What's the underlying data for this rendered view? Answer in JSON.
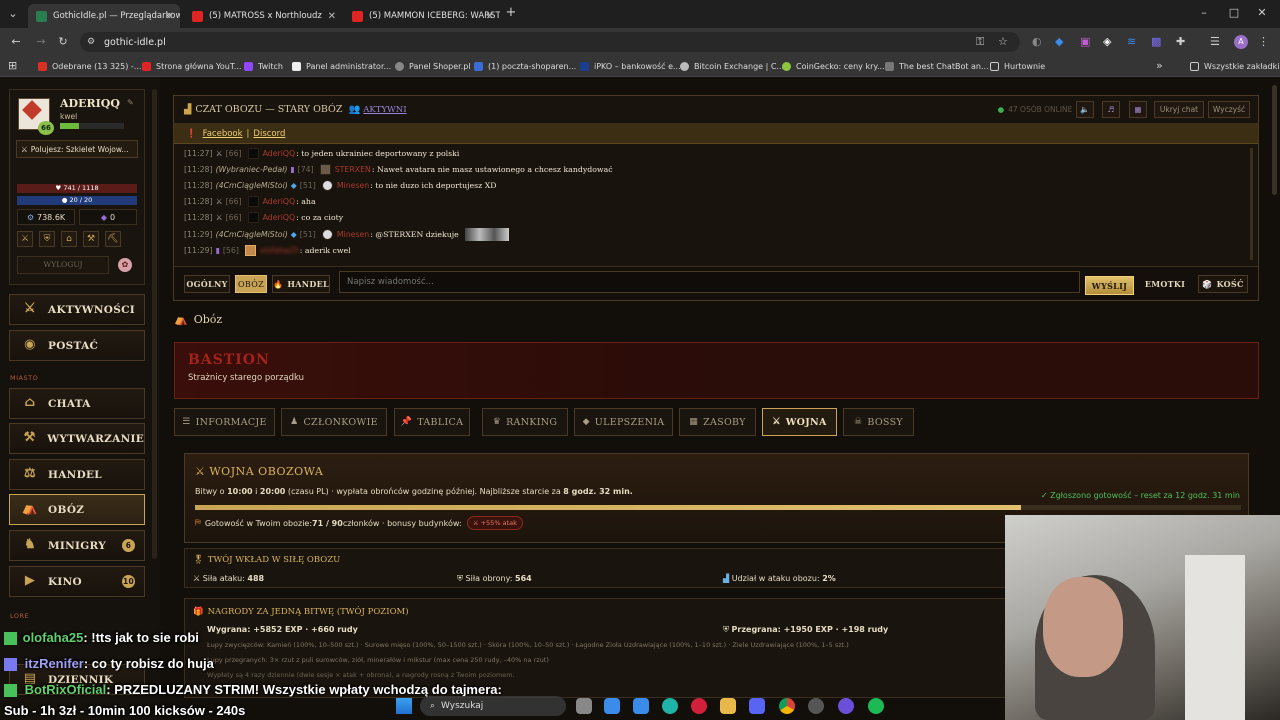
{
  "browser": {
    "tabs": [
      {
        "title": "GothicIdle.pl — Przeglądarkow",
        "active": true,
        "color": "#2a7d4f"
      },
      {
        "title": "(5) MATROSS x Northloudz",
        "active": false,
        "color": "#e02424"
      },
      {
        "title": "(5) MAMMON ICEBERG: WARST",
        "active": false,
        "color": "#e02424"
      }
    ],
    "url": "gothic-idle.pl",
    "bookmarks": [
      {
        "label": "Odebrane (13 325) -...",
        "color": "#d93025"
      },
      {
        "label": "Strona główna YouT...",
        "color": "#e02424"
      },
      {
        "label": "Twitch",
        "color": "#9146ff"
      },
      {
        "label": "Panel administrator...",
        "color": "#eeeeee"
      },
      {
        "label": "Panel Shoper.pl",
        "color": "#888888"
      },
      {
        "label": "(1) poczta-shoparen...",
        "color": "#3b6cd4"
      },
      {
        "label": "iPKO – bankowość e...",
        "color": "#1a3d8f"
      },
      {
        "label": "Bitcoin Exchange | C...",
        "color": "#bbbbbb"
      },
      {
        "label": "CoinGecko: ceny kry...",
        "color": "#8dc63f"
      },
      {
        "label": "The best ChatBot an...",
        "color": "#777777"
      },
      {
        "label": "Hurtownie",
        "color": "#cccccc"
      }
    ],
    "all_bookmarks": "Wszystkie zakładki"
  },
  "profile": {
    "name": "ADERIQQ",
    "subtitle": "kwel",
    "level": "66",
    "hunt_label": "Polujesz: Szkielet Wojow...",
    "hp": "741 / 1118",
    "mana": "20 / 20",
    "gold": "738.6K",
    "gems": "0",
    "logout": "WYLOGUJ"
  },
  "nav": [
    {
      "label": "AKTYWNOŚCI",
      "icon": "⚔"
    },
    {
      "label": "POSTAĆ",
      "icon": "◉"
    }
  ],
  "nav_section_city": "MIASTO",
  "nav_city": [
    {
      "label": "CHATA",
      "icon": "⌂",
      "badge": ""
    },
    {
      "label": "WYTWARZANIE",
      "icon": "⚒",
      "badge": ""
    },
    {
      "label": "HANDEL",
      "icon": "⚖",
      "badge": ""
    },
    {
      "label": "OBÓZ",
      "icon": "⛺",
      "badge": "",
      "selected": true
    },
    {
      "label": "MINIGRY",
      "icon": "♞",
      "badge": "6"
    },
    {
      "label": "KINO",
      "icon": "▶",
      "badge": "10"
    }
  ],
  "nav_section_lore": "LORE",
  "chat": {
    "title": "CZAT OBOZU — STARY OBÓZ",
    "active_label": "AKTYWNI",
    "online": "47 OSÓB ONLINE",
    "hide_btn": "Ukryj chat",
    "clear_btn": "Wyczyść",
    "links": [
      "Facebook",
      "Discord"
    ],
    "messages": [
      {
        "time": "[11:27]",
        "prefix": "",
        "level": "[66]",
        "nick": "AderiQQ",
        "text": ": to jeden ukrainiec deportowany z polski"
      },
      {
        "time": "[11:28]",
        "prefix": "(Wybraniec-Pedał)",
        "level": "[74]",
        "nick": "STERXEN",
        "text": ": Nawet avatara nie masz ustawionego a chcesz kandydować"
      },
      {
        "time": "[11:28]",
        "prefix": "(4CmCiągleMiStoi)",
        "level": "[51]",
        "nick": "Minesen",
        "text": ": to nie duzo ich deportujesz XD"
      },
      {
        "time": "[11:28]",
        "prefix": "",
        "level": "[66]",
        "nick": "AderiQQ",
        "text": ": aha"
      },
      {
        "time": "[11:28]",
        "prefix": "",
        "level": "[66]",
        "nick": "AderiQQ",
        "text": ": co za cioty"
      },
      {
        "time": "[11:29]",
        "prefix": "(4CmCiągleMiStoi)",
        "level": "[51]",
        "nick": "Minesen",
        "text": ": @STERXEN dziekuje"
      },
      {
        "time": "[11:29]",
        "prefix": "",
        "level": "[56]",
        "nick": "olofaha25",
        "text": ": aderik cwel"
      }
    ],
    "channels": [
      "OGÓLNY",
      "OBÓZ",
      "HANDEL"
    ],
    "input_placeholder": "Napisz wiadomość...",
    "send": "WYŚLIJ",
    "emotes": "EMOTKI",
    "dice": "KOŚĆ"
  },
  "section_title": "Obóz",
  "camp": {
    "name": "BASTION",
    "desc": "Strażnicy starego porządku"
  },
  "tabs": [
    {
      "label": "INFORMACJE",
      "icon": "☰"
    },
    {
      "label": "CZŁONKOWIE",
      "icon": "♟"
    },
    {
      "label": "TABLICA",
      "icon": "📌"
    },
    {
      "label": "RANKING",
      "icon": "♛"
    },
    {
      "label": "ULEPSZENIA",
      "icon": "◆"
    },
    {
      "label": "ZASOBY",
      "icon": "▦"
    },
    {
      "label": "WOJNA",
      "icon": "⚔",
      "selected": true
    },
    {
      "label": "BOSSY",
      "icon": "☠"
    }
  ],
  "war": {
    "title": "WOJNA OBOZOWA",
    "schedule_pre": "Bitwy o ",
    "t1": "10:00",
    "mid": " i ",
    "t2": "20:00",
    "schedule_post": " (czasu PL) · wypłata obrońców godzinę później. Najbliższe starcie za ",
    "eta": "8 godz. 32 min.",
    "ready_status": "✓ Zgłoszono gotowość – reset za 12 godz. 31 min",
    "ready_progress": 0.79,
    "readiness_pre": "Gotowość w Twoim obozie: ",
    "readiness_val": "71 / 90",
    "readiness_post": " członków · bonusy budynków:",
    "bonus_badge": "⚔ +55% atak"
  },
  "contrib": {
    "title": "TWÓJ WKŁAD W SIŁĘ OBOZU",
    "attack_label": "Siła ataku: ",
    "attack": "488",
    "defense_label": "Siła obrony: ",
    "defense": "564",
    "share_label": "Udział w ataku obozu: ",
    "share": "2%"
  },
  "rewards": {
    "title": "NAGRODY ZA JEDNĄ BITWĘ (TWÓJ POZIOM)",
    "win": "Wygrana: +5852 EXP · +660 rudy",
    "loss": "Przegrana: +1950 EXP · +198 rudy",
    "loot_line": "Łupy zwycięzców: Kamień (100%, 10–500 szt.) · Surowe mięso (100%, 50–1500 szt.) · Skóra (100%, 10–50 szt.) · Łagodne Zioła Uzdrawiające (100%, 1–10 szt.) · Ziele Uzdrawiające (100%, 1–5 szt.)",
    "loss_line": "Łupy przegranych: 3× rzut z puli surowców, ziół, minerałów i mikstur (max cena 250 rudy, –40% na rzut)",
    "limit_line": "Wypłaty są 4 razy dziennie (dwie sesje × atak + obrona), a nagrody rosną z Twoim poziomem."
  },
  "stream": {
    "l1_user": "olofaha25",
    "l1_text": ": !tts jak to sie robi",
    "l2_user": "itzRenifer",
    "l2_text": ": co ty robisz do huja",
    "l3_user": "BotRixOficial",
    "l3_text": ": PRZEDLUZANY STRIM! Wszystkie wpłaty wchodzą do tajmera:",
    "l4_text": "Sub - 1h 3zł - 10min 100 kicksów - 240s",
    "partial_text": "DZIENNIK"
  },
  "taskbar": {
    "search": "Wyszukaj"
  }
}
